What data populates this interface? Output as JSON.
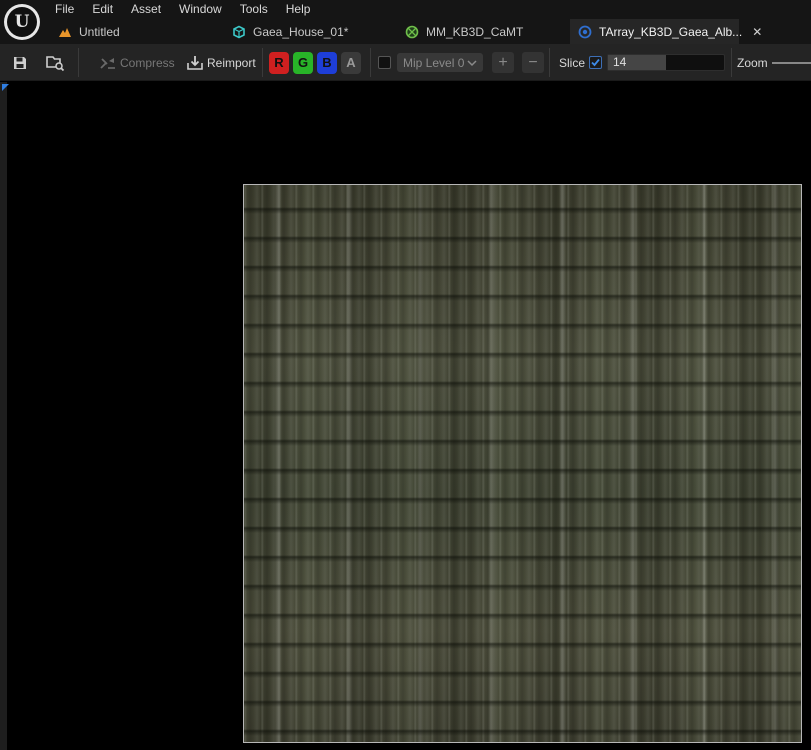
{
  "menu": [
    "File",
    "Edit",
    "Asset",
    "Window",
    "Tools",
    "Help"
  ],
  "tabs": [
    {
      "label": "Untitled",
      "icon": "level-icon",
      "icon_color": "#e8952a"
    },
    {
      "label": "Gaea_House_01*",
      "icon": "mesh-icon",
      "icon_color": "#3cc8c8"
    },
    {
      "label": "MM_KB3D_CaMT",
      "icon": "material-icon",
      "icon_color": "#6fbf4a"
    },
    {
      "label": "TArray_KB3D_Gaea_Alb...",
      "icon": "texture-array-icon",
      "icon_color": "#2f6fd0",
      "active": true
    }
  ],
  "toolbar": {
    "compress_label": "Compress",
    "reimport_label": "Reimport",
    "channels": [
      {
        "label": "R",
        "color": "#d02020"
      },
      {
        "label": "G",
        "color": "#28b428"
      },
      {
        "label": "B",
        "color": "#1e3ed8"
      },
      {
        "label": "A",
        "color": "#3a3a3a"
      }
    ],
    "mip_label": "Mip Level 0",
    "slice_label": "Slice",
    "slice_value": "14",
    "slice_fill_fraction": 0.5,
    "zoom_label": "Zoom"
  },
  "colors": {
    "accent": "#2f7de0",
    "panel": "#242424",
    "titlebar": "#151515"
  }
}
